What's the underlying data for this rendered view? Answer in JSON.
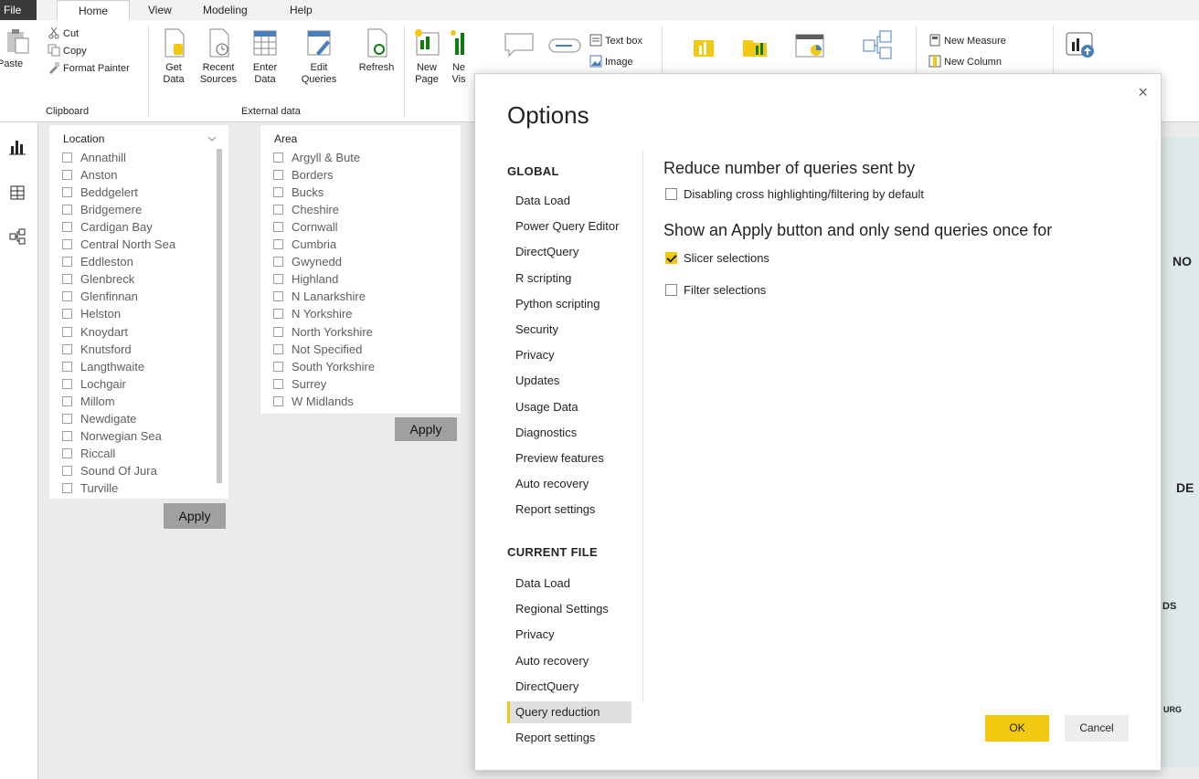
{
  "menubar": {
    "tabs": [
      "File",
      "Home",
      "View",
      "Modeling",
      "Help"
    ]
  },
  "ribbon": {
    "clipboard": {
      "paste": "Paste",
      "cut": "Cut",
      "copy": "Copy",
      "format_painter": "Format Painter",
      "group": "Clipboard"
    },
    "external": {
      "get_data": "Get Data",
      "recent_sources": "Recent Sources",
      "enter_data": "Enter Data",
      "edit_queries": "Edit Queries",
      "refresh": "Refresh",
      "group": "External data"
    },
    "insert": {
      "new_page": "New Page",
      "new_visual": "Ne Vis",
      "text_box": "Text box",
      "image": "Image"
    },
    "calc": {
      "new_measure": "New Measure",
      "new_column": "New Column"
    }
  },
  "slicers": {
    "location": {
      "header": "Location",
      "items": [
        "Annathill",
        "Anston",
        "Beddgelert",
        "Bridgemere",
        "Cardigan Bay",
        "Central North Sea",
        "Eddleston",
        "Glenbreck",
        "Glenfinnan",
        "Helston",
        "Knoydart",
        "Knutsford",
        "Langthwaite",
        "Lochgair",
        "Millom",
        "Newdigate",
        "Norwegian Sea",
        "Riccall",
        "Sound Of Jura",
        "Turville"
      ],
      "apply": "Apply"
    },
    "area": {
      "header": "Area",
      "items": [
        "Argyll & Bute",
        "Borders",
        "Bucks",
        "Cheshire",
        "Cornwall",
        "Cumbria",
        "Gwynedd",
        "Highland",
        "N Lanarkshire",
        "N Yorkshire",
        "North Yorkshire",
        "Not Specified",
        "South Yorkshire",
        "Surrey",
        "W Midlands"
      ],
      "apply": "Apply"
    }
  },
  "map": {
    "labels": [
      "NO",
      "DE",
      "DS",
      "URG"
    ]
  },
  "dialog": {
    "title": "Options",
    "close_glyph": "×",
    "global_header": "GLOBAL",
    "global_items": [
      "Data Load",
      "Power Query Editor",
      "DirectQuery",
      "R scripting",
      "Python scripting",
      "Security",
      "Privacy",
      "Updates",
      "Usage Data",
      "Diagnostics",
      "Preview features",
      "Auto recovery",
      "Report settings"
    ],
    "current_header": "CURRENT FILE",
    "current_items": [
      "Data Load",
      "Regional Settings",
      "Privacy",
      "Auto recovery",
      "DirectQuery",
      "Query reduction",
      "Report settings"
    ],
    "selected_item": "Query reduction",
    "section1_title": "Reduce number of queries sent by",
    "section1_option": "Disabling cross highlighting/filtering by default",
    "section1_checked": false,
    "section2_title": "Show an Apply button and only send queries once for",
    "section2_option_a": "Slicer selections",
    "section2_option_a_checked": true,
    "section2_option_b": "Filter selections",
    "section2_option_b_checked": false,
    "ok": "OK",
    "cancel": "Cancel",
    "accent_color": "#f2c811"
  }
}
